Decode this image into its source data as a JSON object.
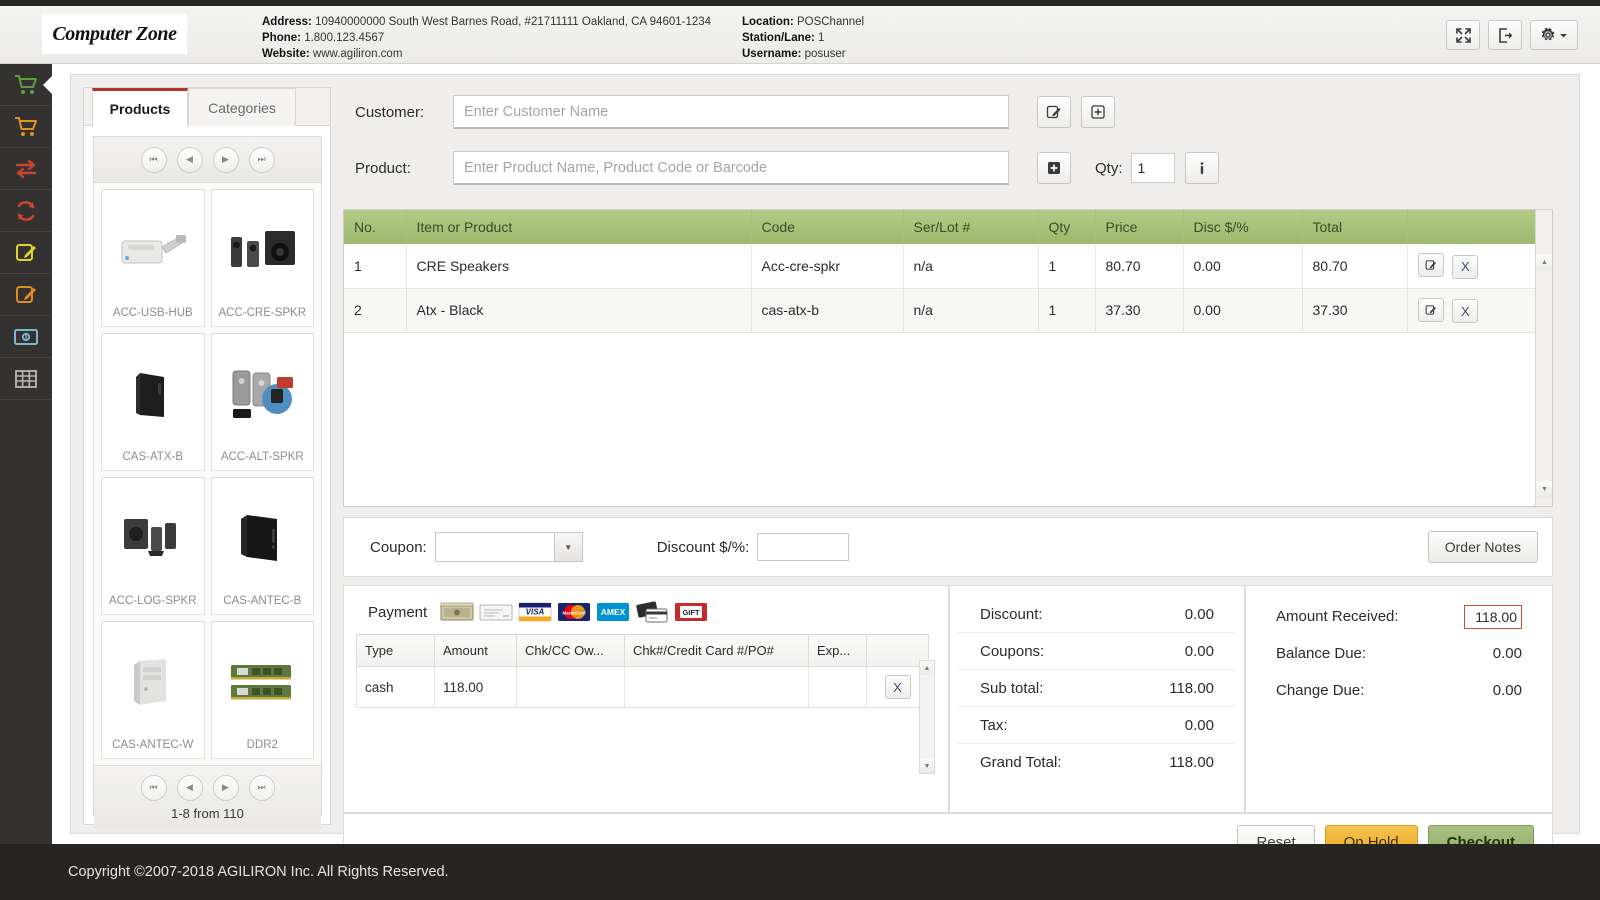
{
  "header": {
    "logo_text": "Computer Zone",
    "fields_left": [
      {
        "label": "Address:",
        "value": "10940000000 South West Barnes Road, #21711111 Oakland, CA 94601-1234"
      },
      {
        "label": "Phone:",
        "value": "1.800.123.4567"
      },
      {
        "label": "Website:",
        "value": "www.agiliron.com"
      }
    ],
    "fields_right": [
      {
        "label": "Location:",
        "value": "POSChannel"
      },
      {
        "label": "Station/Lane:",
        "value": "1"
      },
      {
        "label": "Username:",
        "value": "posuser"
      }
    ],
    "buttons": [
      {
        "name": "fullscreen-button",
        "icon": "expand-icon"
      },
      {
        "name": "logout-button",
        "icon": "logout-icon"
      },
      {
        "name": "settings-button",
        "icon": "gear-icon"
      }
    ]
  },
  "sidebar": {
    "items": [
      {
        "name": "sidebar-item-new-order",
        "icon": "cart-green-icon",
        "color": "#5f9e3f",
        "active": true
      },
      {
        "name": "sidebar-item-orders",
        "icon": "cart-orange-icon",
        "color": "#e09422",
        "active": false
      },
      {
        "name": "sidebar-item-exchange",
        "icon": "exchange-arrows-icon",
        "color": "#c8472c",
        "active": false
      },
      {
        "name": "sidebar-item-refresh",
        "icon": "refresh-icon",
        "color": "#c8472c",
        "active": false
      },
      {
        "name": "sidebar-item-edit-yellow",
        "icon": "edit-note-yellow-icon",
        "color": "#e3d22a",
        "active": false
      },
      {
        "name": "sidebar-item-edit-orange",
        "icon": "edit-note-orange-icon",
        "color": "#e08a22",
        "active": false
      },
      {
        "name": "sidebar-item-cash-drawer",
        "icon": "banknote-icon",
        "color": "#7fb5cd",
        "active": false
      },
      {
        "name": "sidebar-item-grid",
        "icon": "grid-table-icon",
        "color": "#b9b7b4",
        "active": false
      }
    ]
  },
  "products_panel": {
    "tabs": [
      {
        "label": "Products",
        "active": true
      },
      {
        "label": "Categories",
        "active": false
      }
    ],
    "pager_buttons": [
      "first",
      "prev",
      "next",
      "last"
    ],
    "pager_label": "1-8 from 110",
    "items": [
      {
        "code": "ACC-USB-HUB",
        "thumb": "usb-hub-thumb"
      },
      {
        "code": "ACC-CRE-SPKR",
        "thumb": "creative-speakers-thumb"
      },
      {
        "code": "CAS-ATX-B",
        "thumb": "atx-case-black-thumb"
      },
      {
        "code": "ACC-ALT-SPKR",
        "thumb": "altec-speakers-thumb"
      },
      {
        "code": "ACC-LOG-SPKR",
        "thumb": "logitech-speakers-thumb"
      },
      {
        "code": "CAS-ANTEC-B",
        "thumb": "antec-case-black-thumb"
      },
      {
        "code": "CAS-ANTEC-W",
        "thumb": "antec-case-white-thumb"
      },
      {
        "code": "DDR2",
        "thumb": "ddr2-memory-thumb"
      }
    ]
  },
  "form": {
    "customer_label": "Customer:",
    "customer_value": "",
    "customer_placeholder": "Enter Customer Name",
    "product_label": "Product:",
    "product_value": "",
    "product_placeholder": "Enter Product Name, Product Code or Barcode",
    "qty_label": "Qty:",
    "qty_value": "1",
    "buttons": [
      {
        "name": "edit-customer-button",
        "icon": "edit-pencil-icon"
      },
      {
        "name": "add-customer-button",
        "icon": "plus-box-icon"
      },
      {
        "name": "add-product-button",
        "icon": "plus-box-filled-icon"
      },
      {
        "name": "product-info-button",
        "icon": "info-icon"
      }
    ]
  },
  "items_table": {
    "columns": [
      "No.",
      "Item or Product",
      "Code",
      "Ser/Lot #",
      "Qty",
      "Price",
      "Disc $/%",
      "Total",
      ""
    ],
    "rows": [
      {
        "no": "1",
        "item": "CRE Speakers",
        "code": "Acc-cre-spkr",
        "serlot": "n/a",
        "qty": "1",
        "price": "80.70",
        "disc": "0.00",
        "total": "80.70"
      },
      {
        "no": "2",
        "item": "Atx - Black",
        "code": "cas-atx-b",
        "serlot": "n/a",
        "qty": "1",
        "price": "37.30",
        "disc": "0.00",
        "total": "37.30"
      }
    ],
    "row_edit_label": "",
    "row_delete_label": "X"
  },
  "coupon_bar": {
    "coupon_label": "Coupon:",
    "coupon_value": "",
    "discount_label": "Discount $/%:",
    "discount_value": "",
    "order_notes_label": "Order Notes"
  },
  "payment": {
    "label": "Payment",
    "methods": [
      {
        "name": "cash-icon",
        "title": "Cash"
      },
      {
        "name": "check-icon",
        "title": "Check"
      },
      {
        "name": "visa-icon",
        "title": "VISA"
      },
      {
        "name": "mastercard-icon",
        "title": "MasterCard"
      },
      {
        "name": "amex-icon",
        "title": "AMEX"
      },
      {
        "name": "debit-card-icon",
        "title": "Debit"
      },
      {
        "name": "gift-card-icon",
        "title": "GIFT"
      }
    ],
    "columns": [
      "Type",
      "Amount",
      "Chk/CC Ow...",
      "Chk#/Credit Card #/PO#",
      "Exp...",
      ""
    ],
    "rows": [
      {
        "type": "cash",
        "amount": "118.00",
        "owner": "",
        "number": "",
        "exp": "",
        "delete": "X"
      }
    ]
  },
  "totals": {
    "left": [
      {
        "label": "Discount:",
        "value": "0.00"
      },
      {
        "label": "Coupons:",
        "value": "0.00"
      },
      {
        "label": "Sub total:",
        "value": "118.00"
      },
      {
        "label": "Tax:",
        "value": "0.00"
      },
      {
        "label": "Grand Total:",
        "value": "118.00"
      }
    ],
    "right": [
      {
        "label": "Amount Received:",
        "value": "118.00",
        "input": true
      },
      {
        "label": "Balance Due:",
        "value": "0.00",
        "input": false
      },
      {
        "label": "Change Due:",
        "value": "0.00",
        "input": false
      }
    ]
  },
  "actions": {
    "reset_label": "Reset",
    "hold_label": "On Hold",
    "checkout_label": "Checkout"
  },
  "footer": {
    "copyright": "Copyright ©2007-2018 AGILIRON Inc. All Rights Reserved."
  },
  "colors": {
    "table_header_green": "#9cb96d",
    "checkout_green": "#8fae63",
    "hold_orange": "#e9a623",
    "focus_orange": "#c7522e",
    "tab_accent_red": "#b3322b",
    "rail_dark": "#333230"
  }
}
